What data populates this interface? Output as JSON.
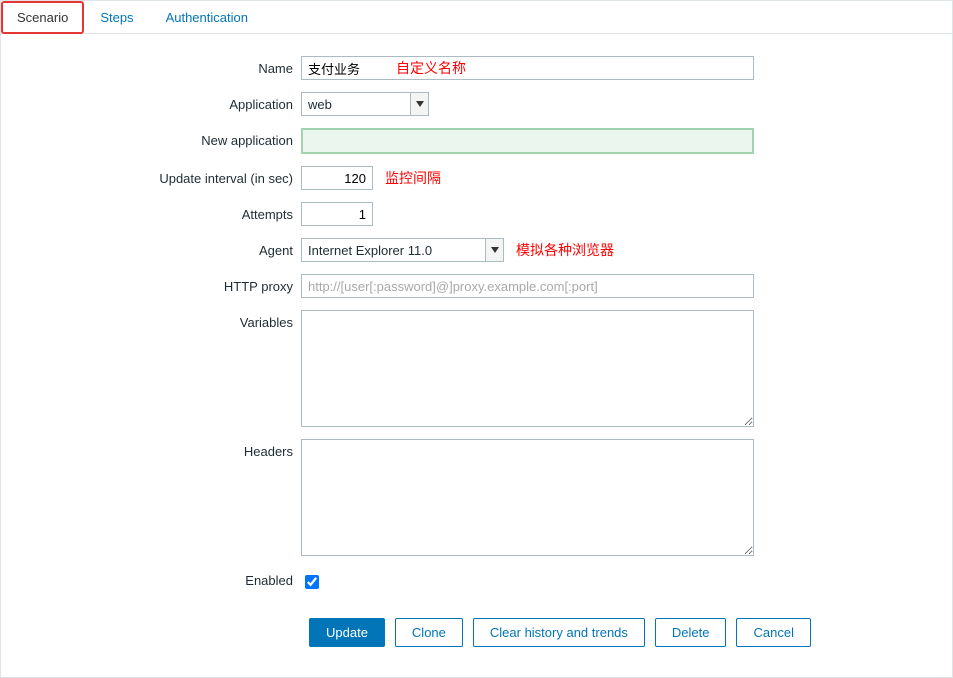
{
  "tabs": {
    "scenario": "Scenario",
    "steps": "Steps",
    "authentication": "Authentication"
  },
  "labels": {
    "name": "Name",
    "application": "Application",
    "new_application": "New application",
    "update_interval": "Update interval (in sec)",
    "attempts": "Attempts",
    "agent": "Agent",
    "http_proxy": "HTTP proxy",
    "variables": "Variables",
    "headers": "Headers",
    "enabled": "Enabled"
  },
  "fields": {
    "name_value": "支付业务",
    "application_value": "web",
    "new_application_value": "",
    "update_interval_value": "120",
    "attempts_value": "1",
    "agent_value": "Internet Explorer 11.0",
    "http_proxy_placeholder": "http://[user[:password]@]proxy.example.com[:port]",
    "variables_value": "",
    "headers_value": "",
    "enabled_checked": true
  },
  "annotations": {
    "name": "自定义名称",
    "update_interval": "监控间隔",
    "agent": "模拟各种浏览器"
  },
  "buttons": {
    "update": "Update",
    "clone": "Clone",
    "clear": "Clear history and trends",
    "delete": "Delete",
    "cancel": "Cancel"
  }
}
